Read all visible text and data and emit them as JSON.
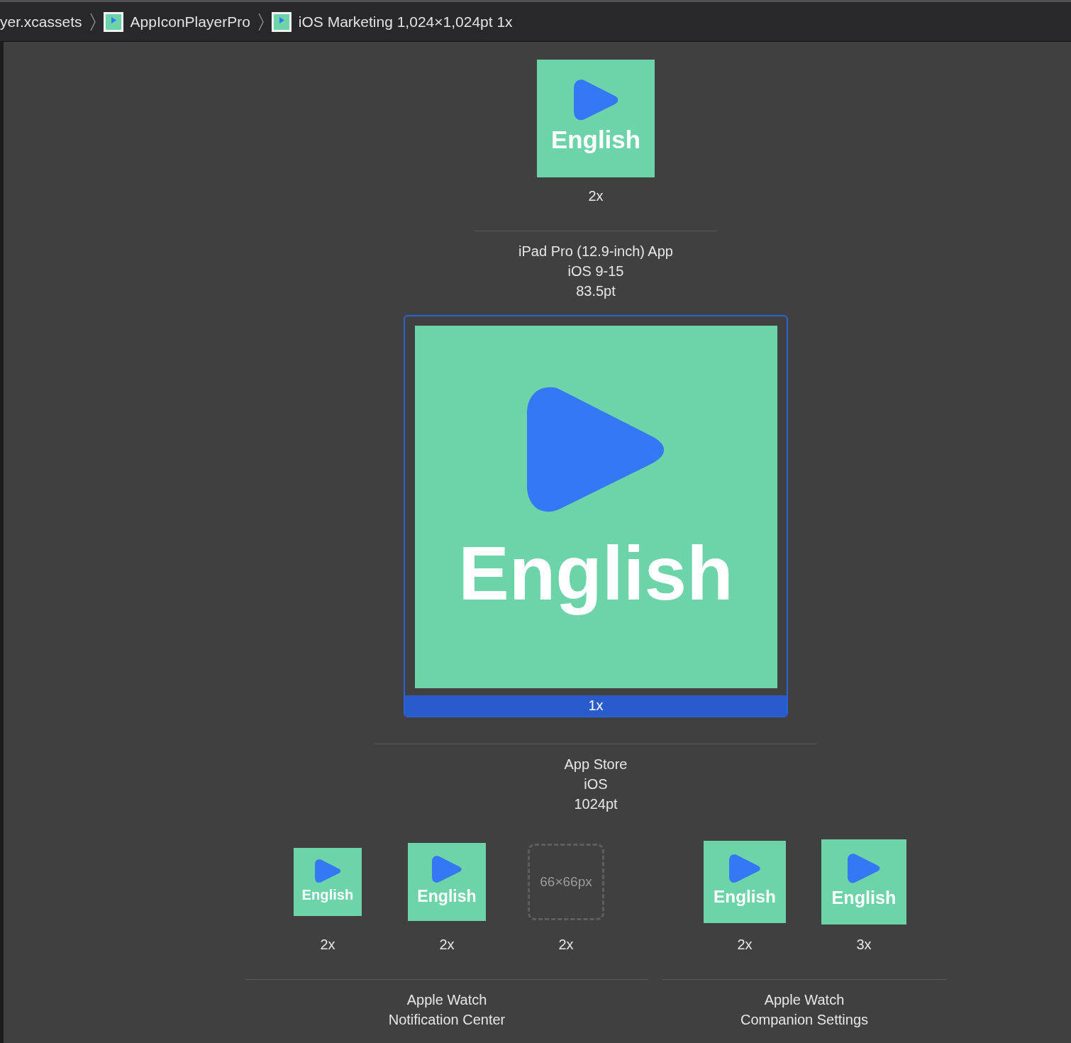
{
  "breadcrumb": [
    {
      "kind": "plain",
      "text": "yer.xcassets"
    },
    {
      "kind": "iconset",
      "text": "AppIconPlayerPro"
    },
    {
      "kind": "iconset",
      "text": "iOS Marketing 1,024×1,024pt 1x"
    }
  ],
  "sections": [
    {
      "groups": [
        {
          "slots": [
            {
              "kind": "image",
              "label": "English",
              "scale": "2x",
              "selected": false
            }
          ],
          "caption": [
            "iPad Pro (12.9-inch) App",
            "iOS 9-15",
            "83.5pt"
          ]
        }
      ]
    },
    {
      "groups": [
        {
          "slots": [
            {
              "kind": "image",
              "label": "English",
              "scale": "1x",
              "selected": true
            }
          ],
          "caption": [
            "App Store",
            "iOS",
            "1024pt"
          ]
        }
      ]
    },
    {
      "groups": [
        {
          "slots": [
            {
              "kind": "image",
              "label": "English",
              "scale": "2x",
              "selected": false
            },
            {
              "kind": "image",
              "label": "English",
              "scale": "2x",
              "selected": false
            },
            {
              "kind": "empty",
              "size_text": "66×66px",
              "scale": "2x",
              "selected": false
            }
          ],
          "caption": [
            "Apple Watch",
            "Notification Center"
          ]
        },
        {
          "slots": [
            {
              "kind": "image",
              "label": "English",
              "scale": "2x",
              "selected": false
            },
            {
              "kind": "image",
              "label": "English",
              "scale": "3x",
              "selected": false
            }
          ],
          "caption": [
            "Apple Watch",
            "Companion Settings"
          ]
        }
      ]
    }
  ]
}
